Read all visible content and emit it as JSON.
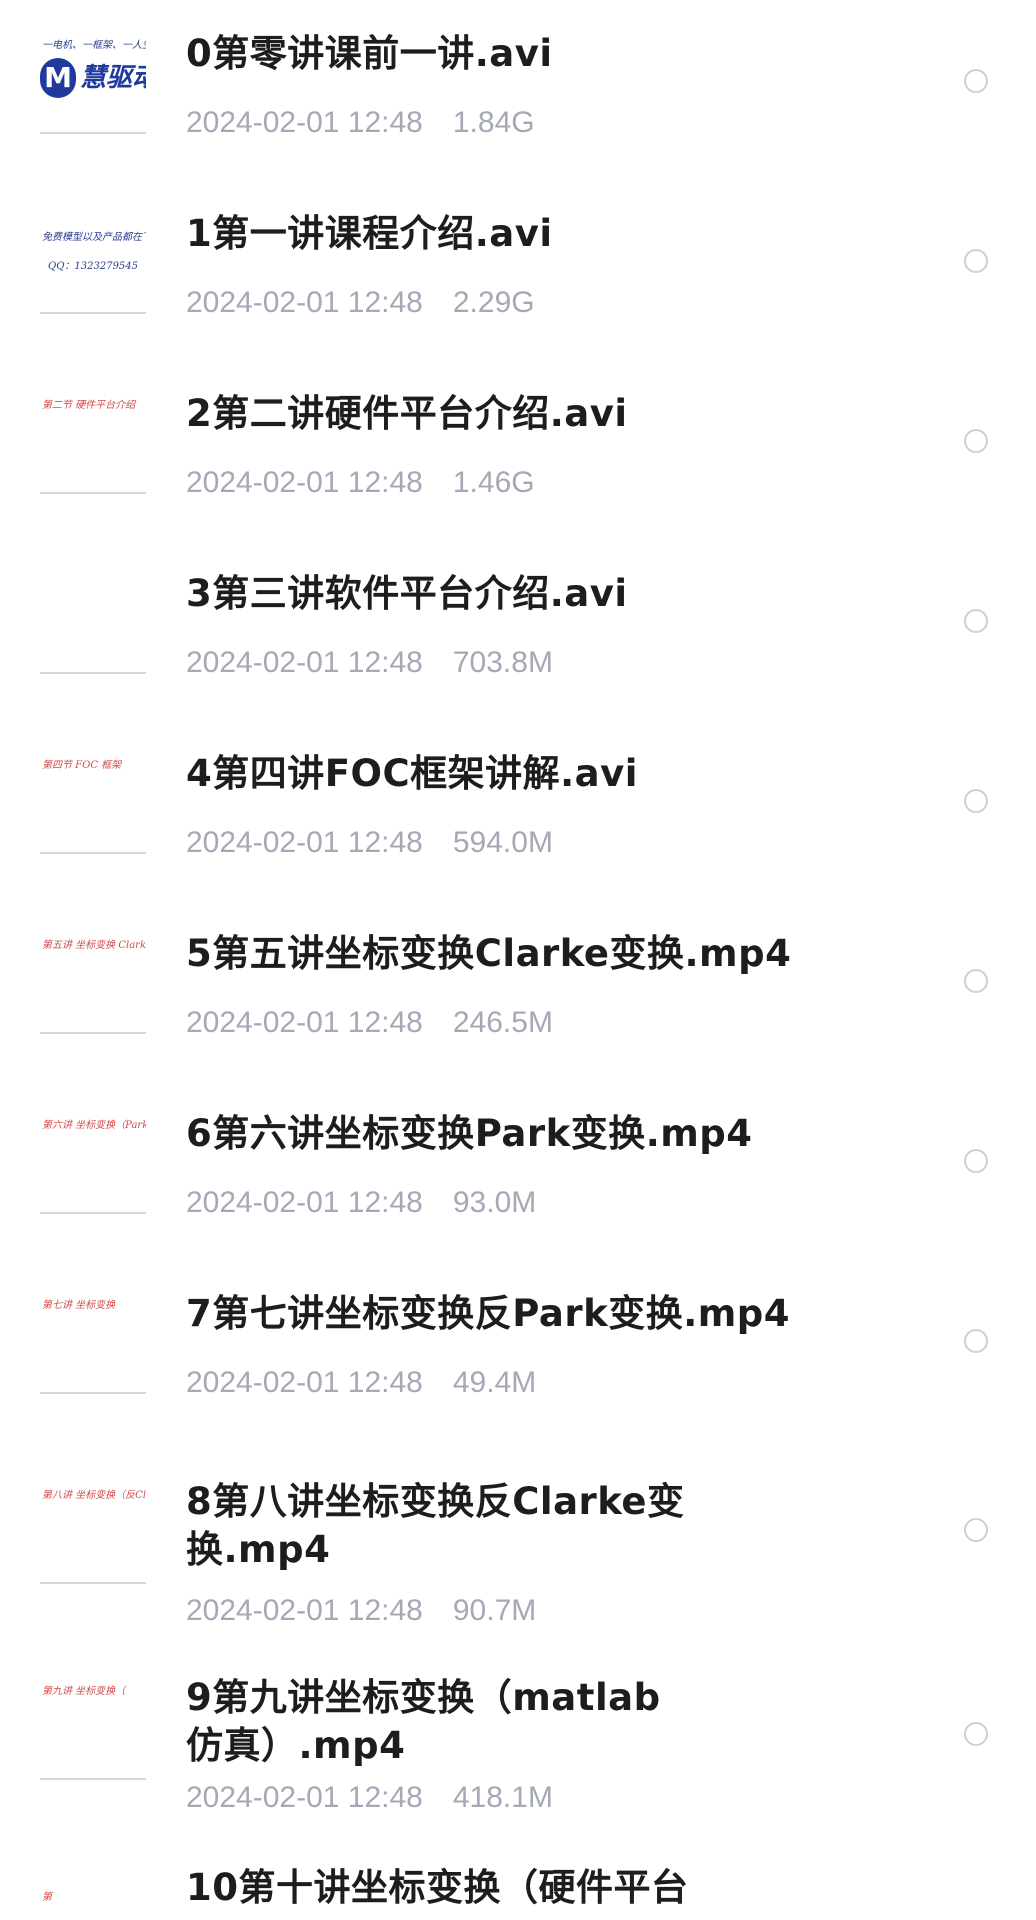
{
  "files": [
    {
      "title": "0第零讲课前一讲.avi",
      "date": "2024-02-01 12:48",
      "size": "1.84G"
    },
    {
      "title": "1第一讲课程介绍.avi",
      "date": "2024-02-01 12:48",
      "size": "2.29G"
    },
    {
      "title": "2第二讲硬件平台介绍.avi",
      "date": "2024-02-01 12:48",
      "size": "1.46G"
    },
    {
      "title": "3第三讲软件平台介绍.avi",
      "date": "2024-02-01 12:48",
      "size": "703.8M"
    },
    {
      "title": "4第四讲FOC框架讲解.avi",
      "date": "2024-02-01 12:48",
      "size": "594.0M"
    },
    {
      "title": "5第五讲坐标变换Clarke变换.mp4",
      "date": "2024-02-01 12:48",
      "size": "246.5M"
    },
    {
      "title": "6第六讲坐标变换Park变换.mp4",
      "date": "2024-02-01 12:48",
      "size": "93.0M"
    },
    {
      "title": "7第七讲坐标变换反Park变换.mp4",
      "date": "2024-02-01 12:48",
      "size": "49.4M"
    },
    {
      "title": "8第八讲坐标变换反Clarke变换.mp4",
      "date": "2024-02-01 12:48",
      "size": "90.7M"
    },
    {
      "title": "9第九讲坐标变换（matlab仿真）.mp4",
      "date": "2024-02-01 12:48",
      "size": "418.1M"
    },
    {
      "title": "10第十讲坐标变换（硬件平台"
    }
  ],
  "thumbnails": [
    {
      "caption": "一电机、一框架、一人生",
      "logo_letter": "M",
      "logo_text": "慧驱动"
    },
    {
      "caption": "免费模型以及产品都在下面",
      "contact": "QQ：1323279545"
    },
    {
      "caption": "第二节 硬件平台介绍"
    },
    {
      "caption": ""
    },
    {
      "caption": "第四节 FOC 框架"
    },
    {
      "caption": "第五讲 坐标变换 Clarke"
    },
    {
      "caption": "第六讲 坐标变换（Park变换"
    },
    {
      "caption": "第七讲 坐标变换"
    },
    {
      "caption": "第八讲 坐标变换（反Clarke"
    },
    {
      "caption": "第九讲 坐标变换（"
    },
    {
      "caption": "第"
    }
  ],
  "colors": {
    "title_text": "#1d1d1d",
    "meta_text": "#a5a8b6",
    "radio_border": "#cfcfcf",
    "logo_blue": "#1f3a9c",
    "handwriting_red": "#d04a4a"
  }
}
